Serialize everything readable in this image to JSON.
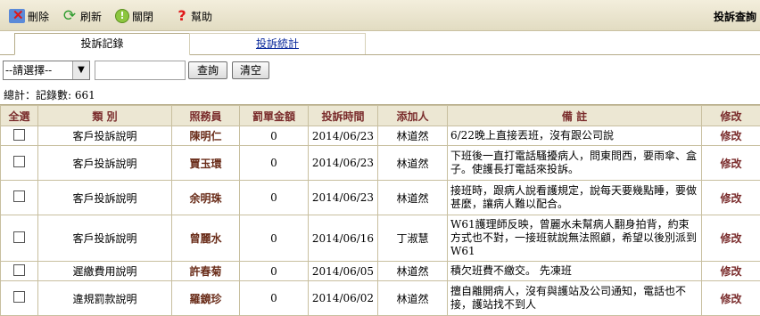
{
  "toolbar": {
    "delete_label": "刪除",
    "refresh_label": "刷新",
    "close_label": "關閉",
    "help_label": "幫助",
    "page_title": "投訴查詢"
  },
  "tabs": [
    {
      "label": "投訴記錄",
      "active": true
    },
    {
      "label": "投訴統計",
      "active": false
    }
  ],
  "search": {
    "select_value": "--請選擇--",
    "keyword_value": "",
    "search_button": "查詢",
    "clear_button": "清空"
  },
  "summary": "總計：記錄數: 661",
  "table": {
    "headers": [
      "全選",
      "類 別",
      "照務員",
      "罰單金額",
      "投訴時間",
      "添加人",
      "備 註",
      "修改"
    ],
    "rows": [
      {
        "category": "客戶投訴說明",
        "staff": "陳明仁",
        "amount": "0",
        "date": "2014/06/23",
        "added_by": "林道然",
        "memo": "6/22晚上直接丟班，沒有跟公司說",
        "edit": "修改"
      },
      {
        "category": "客戶投訴說明",
        "staff": "賈玉環",
        "amount": "0",
        "date": "2014/06/23",
        "added_by": "林道然",
        "memo": "下班後一直打電話騷擾病人，問東問西，要雨傘、盒子。使護長打電話來投訴。",
        "edit": "修改"
      },
      {
        "category": "客戶投訴說明",
        "staff": "余明珠",
        "amount": "0",
        "date": "2014/06/23",
        "added_by": "林道然",
        "memo": "接班時，跟病人說看護規定，說每天要幾點睡，要做甚麼，讓病人難以配合。",
        "edit": "修改"
      },
      {
        "category": "客戶投訴說明",
        "staff": "曾麗水",
        "amount": "0",
        "date": "2014/06/16",
        "added_by": "丁淑慧",
        "memo": "W61護理師反映，曾麗水未幫病人翻身拍背，約束方式也不對，一接班就說無法照顧，希望以後別派到W61",
        "edit": "修改"
      },
      {
        "category": "遲繳費用說明",
        "staff": "許春菊",
        "amount": "0",
        "date": "2014/06/05",
        "added_by": "林道然",
        "memo": "積欠班費不繳交。 先凍班",
        "edit": "修改"
      },
      {
        "category": "違規罰款說明",
        "staff": "羅鏡珍",
        "amount": "0",
        "date": "2014/06/02",
        "added_by": "林道然",
        "memo": "擅自離開病人，沒有與護站及公司通知，電話也不接，護站找不到人",
        "edit": "修改"
      }
    ]
  }
}
